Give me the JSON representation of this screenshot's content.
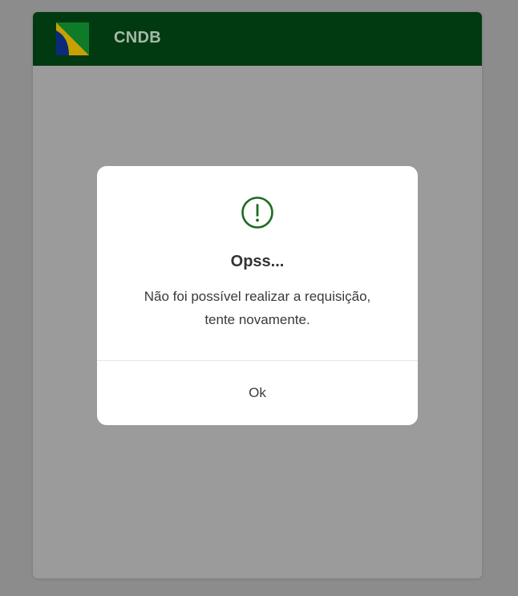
{
  "header": {
    "logo_icon": "brazil-flag-icon",
    "title": "CNDB",
    "background": "#013a11"
  },
  "modal": {
    "icon": "alert-circle-icon",
    "icon_color": "#1c6b1f",
    "title": "Opss...",
    "message_line1": "Não foi possível realizar a requisição,",
    "message_line2": "tente novamente.",
    "ok_label": "Ok"
  },
  "colors": {
    "overlay": "#8c8c8c",
    "card_dimmed": "#9b9b9b",
    "modal_bg": "#ffffff"
  }
}
